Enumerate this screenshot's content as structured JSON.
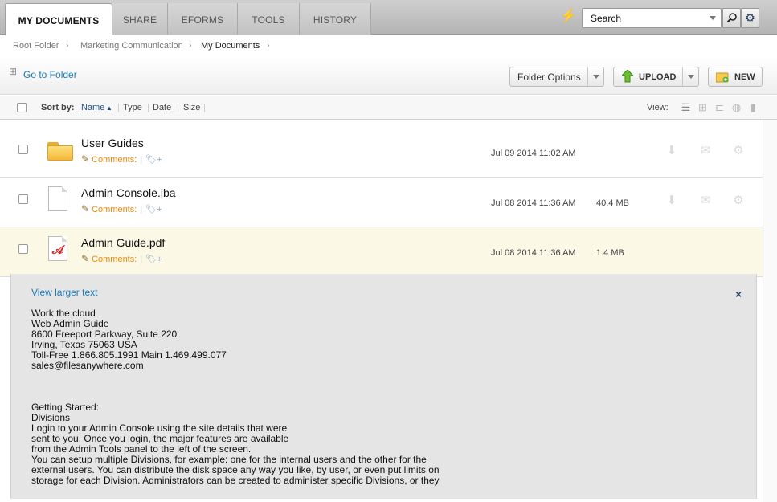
{
  "tabs": [
    {
      "label": "MY DOCUMENTS",
      "active": true
    },
    {
      "label": "SHARE",
      "active": false
    },
    {
      "label": "EFORMS",
      "active": false
    },
    {
      "label": "TOOLS",
      "active": false
    },
    {
      "label": "HISTORY",
      "active": false
    }
  ],
  "search": {
    "value": "Search"
  },
  "breadcrumb": [
    "Root Folder",
    "Marketing Communication",
    "My Documents"
  ],
  "toolbar": {
    "goto_label": "Go to Folder",
    "folder_options_label": "Folder Options",
    "upload_label": "UPLOAD",
    "new_label": "NEW"
  },
  "sortbar": {
    "sort_by_label": "Sort by:",
    "columns": [
      "Name",
      "Type",
      "Date",
      "Size"
    ],
    "view_label": "View:"
  },
  "files": [
    {
      "name": "User Guides",
      "type": "folder",
      "comments_label": "Comments:",
      "date": "Jul 09 2014 11:02 AM",
      "size": ""
    },
    {
      "name": "Admin Console.iba",
      "type": "file",
      "comments_label": "Comments:",
      "date": "Jul 08 2014 11:36 AM",
      "size": "40.4 MB"
    },
    {
      "name": "Admin Guide.pdf",
      "type": "pdf",
      "comments_label": "Comments:",
      "date": "Jul 08 2014 11:36 AM",
      "size": "1.4 MB"
    }
  ],
  "preview": {
    "link_label": "View larger text",
    "close_label": "×",
    "lines": [
      "Work the cloud",
      "Web Admin Guide",
      "8600 Freeport Parkway, Suite 220",
      "Irving, Texas 75063 USA",
      "Toll-Free 1.866.805.1991 Main 1.469.499.077",
      "sales@filesanywhere.com",
      "",
      "",
      "",
      "Getting Started:",
      "Divisions",
      "Login to your Admin Console using the site details that were",
      "sent to you. Once you login, the major features are available",
      "from the Admin Tools panel to the left of the screen.",
      "You can setup multiple Divisions, for example: one for the internal users and the other for the",
      "external users. You can distribute the disk space any way you like, by user, or even put limits on",
      "storage for each Division. Administrators can be created to administer specific Divisions, or they"
    ]
  },
  "colors": {
    "link": "#1e7ab6",
    "comments": "#e98a0e",
    "selected_row": "#fbf8e6",
    "preview_bg": "#e5e5e5"
  }
}
